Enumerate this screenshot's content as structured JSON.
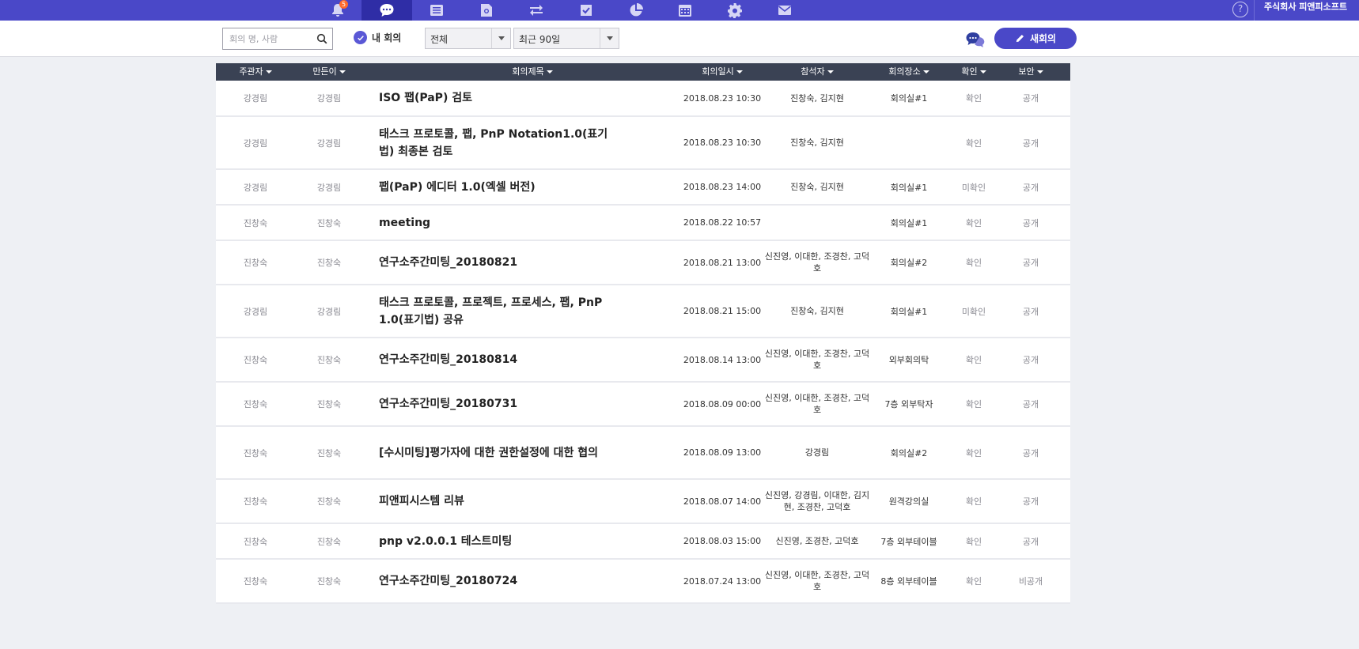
{
  "topbar": {
    "icons": [
      {
        "name": "bell-icon",
        "badge": "5"
      },
      {
        "name": "chat-icon"
      },
      {
        "name": "list-icon"
      },
      {
        "name": "document-search-icon"
      },
      {
        "name": "transfer-icon"
      },
      {
        "name": "checkbox-icon"
      },
      {
        "name": "pie-chart-icon"
      },
      {
        "name": "calendar-icon"
      },
      {
        "name": "gear-icon"
      },
      {
        "name": "mail-icon"
      }
    ],
    "help_label": "?",
    "company_name": "주식회사 피앤피소프트"
  },
  "toolbar": {
    "search_placeholder": "회의 명, 사람",
    "my_meetings_label": "내 회의",
    "filter_all": "전체",
    "filter_period": "최근 90일",
    "new_meeting_label": "새회의"
  },
  "table": {
    "headers": [
      "주관자",
      "만든이",
      "회의제목",
      "회의일시",
      "참석자",
      "회의장소",
      "확인",
      "보안"
    ],
    "rows": [
      {
        "host": "강경림",
        "creator": "강경림",
        "title": "ISO 팹(PaP) 검토",
        "datetime": "2018.08.23 10:30",
        "attendees": "진창숙, 김지현",
        "place": "회의실#1",
        "confirm": "확인",
        "security": "공개"
      },
      {
        "host": "강경림",
        "creator": "강경림",
        "title": "태스크 프로토콜, 팹, PnP Notation1.0(표기법) 최종본 검토",
        "datetime": "2018.08.23 10:30",
        "attendees": "진창숙, 김지현",
        "place": "",
        "confirm": "확인",
        "security": "공개"
      },
      {
        "host": "강경림",
        "creator": "강경림",
        "title": "팹(PaP) 에디터 1.0(엑셀 버전)",
        "datetime": "2018.08.23 14:00",
        "attendees": "진창숙, 김지현",
        "place": "회의실#1",
        "confirm": "미확인",
        "security": "공개"
      },
      {
        "host": "진창숙",
        "creator": "진창숙",
        "title": "meeting",
        "datetime": "2018.08.22 10:57",
        "attendees": "",
        "place": "회의실#1",
        "confirm": "확인",
        "security": "공개"
      },
      {
        "host": "진창숙",
        "creator": "진창숙",
        "title": "연구소주간미팅_20180821",
        "datetime": "2018.08.21 13:00",
        "attendees": "신진영, 이대한, 조경찬, 고덕호",
        "place": "회의실#2",
        "confirm": "확인",
        "security": "공개"
      },
      {
        "host": "강경림",
        "creator": "강경림",
        "title": "태스크 프로토콜, 프로젝트, 프로세스, 팹, PnP 1.0(표기법) 공유",
        "datetime": "2018.08.21 15:00",
        "attendees": "진창숙, 김지현",
        "place": "회의실#1",
        "confirm": "미확인",
        "security": "공개"
      },
      {
        "host": "진창숙",
        "creator": "진창숙",
        "title": "연구소주간미팅_20180814",
        "datetime": "2018.08.14 13:00",
        "attendees": "신진영, 이대한, 조경찬, 고덕호",
        "place": "외부회의탁",
        "confirm": "확인",
        "security": "공개"
      },
      {
        "host": "진창숙",
        "creator": "진창숙",
        "title": "연구소주간미팅_20180731",
        "datetime": "2018.08.09 00:00",
        "attendees": "신진영, 이대한, 조경찬, 고덕호",
        "place": "7층 외부탁자",
        "confirm": "확인",
        "security": "공개"
      },
      {
        "host": "진창숙",
        "creator": "진창숙",
        "title": "[수시미팅]평가자에 대한 권한설정에 대한 협의",
        "datetime": "2018.08.09 13:00",
        "attendees": "강경림",
        "place": "회의실#2",
        "confirm": "확인",
        "security": "공개"
      },
      {
        "host": "진창숙",
        "creator": "진창숙",
        "title": "피앤피시스템 리뷰",
        "datetime": "2018.08.07 14:00",
        "attendees": "신진영, 강경림, 이대한, 김지현, 조경찬, 고덕호",
        "place": "원격강의실",
        "confirm": "확인",
        "security": "공개"
      },
      {
        "host": "진창숙",
        "creator": "진창숙",
        "title": "pnp v2.0.0.1 테스트미팅",
        "datetime": "2018.08.03 15:00",
        "attendees": "신진영, 조경찬, 고덕호",
        "place": "7층 외부테이블",
        "confirm": "확인",
        "security": "공개"
      },
      {
        "host": "진창숙",
        "creator": "진창숙",
        "title": "연구소주간미팅_20180724",
        "datetime": "2018.07.24 13:00",
        "attendees": "신진영, 이대한, 조경찬, 고덕호",
        "place": "8층 외부테이블",
        "confirm": "확인",
        "security": "비공개"
      }
    ]
  }
}
